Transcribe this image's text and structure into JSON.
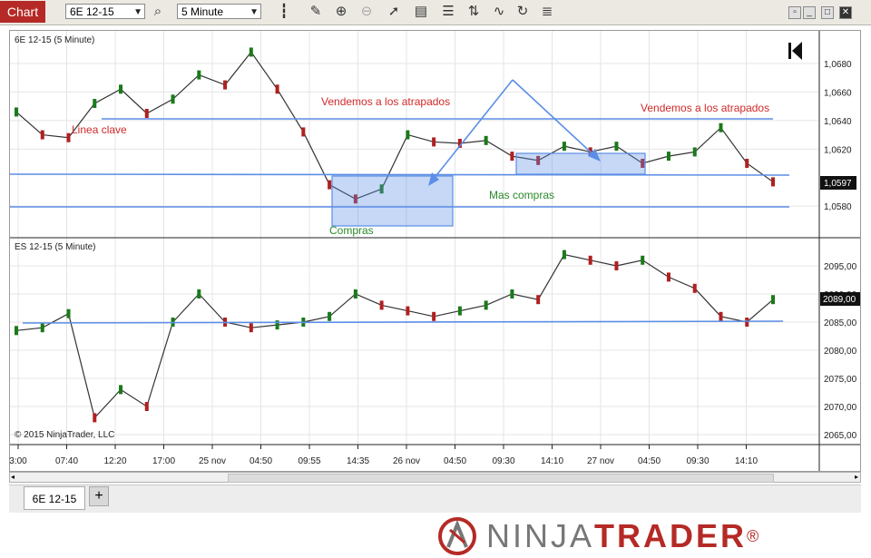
{
  "toolbar": {
    "chart_label": "Chart",
    "instrument_value": "6E 12-15",
    "interval_value": "5 Minute"
  },
  "panels": {
    "top_label": "6E 12-15 (5 Minute)",
    "bottom_label": "ES 12-15 (5 Minute)",
    "copyright": "© 2015 NinjaTrader, LLC"
  },
  "footer": {
    "instrument_tab": "6E 12-15",
    "add_tab": "+",
    "logo_part1": "NINJA",
    "logo_part2": "TRADER",
    "logo_reg": "®"
  },
  "colors": {
    "accent": "#b52a26",
    "line": "#5b8ee6",
    "annotation_red": "#d02a2a",
    "annotation_green": "#2a8a2a",
    "candle_up": "#1a7a1a",
    "candle_down": "#b02020"
  },
  "chart_data": [
    {
      "type": "line",
      "title": "6E 12-15 (5 Minute)",
      "y_ticks": [
        "1,0680",
        "1,0660",
        "1,0640",
        "1,0620",
        "1,0580"
      ],
      "ylim": [
        1.0565,
        1.0695
      ],
      "last_price": "1,0597",
      "x": [
        0,
        6,
        12,
        18,
        24,
        30,
        36,
        42,
        48,
        54,
        60,
        66,
        72,
        78,
        84,
        90,
        96,
        102,
        108,
        114,
        120,
        126,
        132,
        138,
        144,
        150,
        156,
        162,
        168,
        174
      ],
      "values": [
        1.0646,
        1.063,
        1.0628,
        1.0652,
        1.0662,
        1.0645,
        1.0655,
        1.0672,
        1.0665,
        1.0688,
        1.0662,
        1.0632,
        1.0595,
        1.0585,
        1.0592,
        1.063,
        1.0625,
        1.0624,
        1.0626,
        1.0615,
        1.0612,
        1.0622,
        1.0618,
        1.0622,
        1.061,
        1.0615,
        1.0618,
        1.0635,
        1.061,
        1.0597
      ],
      "annotations": [
        "Linea clave",
        "Vendemos a los atrapados",
        "Vendemos a los atrapados",
        "Compras",
        "Mas compras"
      ]
    },
    {
      "type": "line",
      "title": "ES 12-15 (5 Minute)",
      "y_ticks": [
        "2095,00",
        "2090,00",
        "2085,00",
        "2080,00",
        "2075,00",
        "2070,00",
        "2065,00"
      ],
      "ylim": [
        2064,
        2098.5
      ],
      "last_price": "2089,00",
      "x": [
        0,
        6,
        12,
        18,
        24,
        30,
        36,
        42,
        48,
        54,
        60,
        66,
        72,
        78,
        84,
        90,
        96,
        102,
        108,
        114,
        120,
        126,
        132,
        138,
        144,
        150,
        156,
        162,
        168,
        174
      ],
      "values": [
        2083.5,
        2084,
        2086.5,
        2068,
        2073,
        2070,
        2085,
        2090,
        2085,
        2084,
        2084.5,
        2085,
        2086,
        2090,
        2088,
        2087,
        2086,
        2087,
        2088,
        2090,
        2089,
        2097,
        2096,
        2095,
        2096,
        2093,
        2091,
        2086,
        2085,
        2089
      ],
      "x_ticks": [
        "3:00",
        "07:40",
        "12:20",
        "17:00",
        "25 nov",
        "04:50",
        "09:55",
        "14:35",
        "26 nov",
        "04:50",
        "09:30",
        "14:10",
        "27 nov",
        "04:50",
        "09:30",
        "14:10"
      ]
    }
  ]
}
